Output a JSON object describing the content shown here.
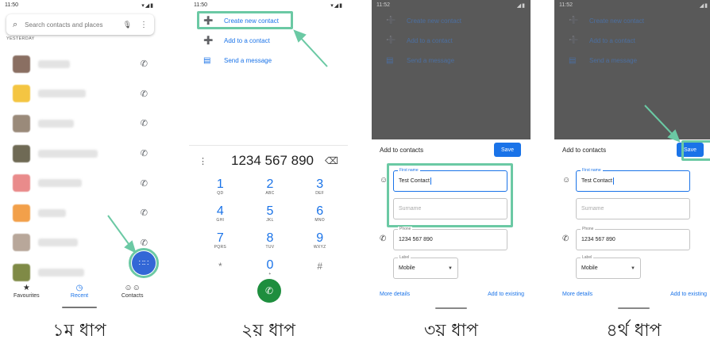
{
  "colors": {
    "accent": "#1a73e8",
    "highlight": "#6bc9a4",
    "call_green": "#1e8e3e",
    "overlay": "#595959"
  },
  "step1": {
    "status_time": "11:50",
    "search_placeholder": "Search contacts and places",
    "section_label": "YESTERDAY",
    "calls": [
      {
        "avatar": "#8a6f62"
      },
      {
        "avatar": "#f4c542"
      },
      {
        "avatar": "#9a8a7a"
      },
      {
        "avatar": "#6f6a55"
      },
      {
        "avatar": "#e98b8b"
      },
      {
        "avatar": "#f2a04a"
      },
      {
        "avatar": "#b8a79a"
      },
      {
        "avatar": "#7f8a46"
      }
    ],
    "nav": [
      {
        "label": "Favourites",
        "icon": "star-icon"
      },
      {
        "label": "Recent",
        "icon": "clock-icon"
      },
      {
        "label": "Contacts",
        "icon": "people-icon"
      }
    ],
    "caption": "১ম ধাপ"
  },
  "step2": {
    "status_time": "11:50",
    "menu": [
      {
        "label": "Create new contact",
        "icon": "person-add-icon"
      },
      {
        "label": "Add to a contact",
        "icon": "person-add-icon"
      },
      {
        "label": "Send a message",
        "icon": "message-icon"
      }
    ],
    "number": "1234 567 890",
    "keys": [
      {
        "digit": "1",
        "letters": "QD"
      },
      {
        "digit": "2",
        "letters": "ABC"
      },
      {
        "digit": "3",
        "letters": "DEF"
      },
      {
        "digit": "4",
        "letters": "GHI"
      },
      {
        "digit": "5",
        "letters": "JKL"
      },
      {
        "digit": "6",
        "letters": "MNO"
      },
      {
        "digit": "7",
        "letters": "PQRS"
      },
      {
        "digit": "8",
        "letters": "TUV"
      },
      {
        "digit": "9",
        "letters": "WXYZ"
      },
      {
        "digit": "*",
        "letters": ""
      },
      {
        "digit": "0",
        "letters": "+"
      },
      {
        "digit": "#",
        "letters": ""
      }
    ],
    "caption": "২য় ধাপ"
  },
  "step3": {
    "status_time": "11:52",
    "title": "Add to contacts",
    "save": "Save",
    "first_name_label": "First name",
    "first_name_value": "Test Contact",
    "surname_placeholder": "Surname",
    "phone_label": "Phone",
    "phone_value": "1234 567 890",
    "type_label": "Label",
    "type_value": "Mobile",
    "more_details": "More details",
    "add_existing": "Add to existing",
    "caption": "৩য় ধাপ"
  },
  "step4": {
    "status_time": "11:52",
    "title": "Add to contacts",
    "save": "Save",
    "first_name_label": "First name",
    "first_name_value": "Test Contact",
    "surname_placeholder": "Surname",
    "phone_label": "Phone",
    "phone_value": "1234 567 890",
    "type_label": "Label",
    "type_value": "Mobile",
    "more_details": "More details",
    "add_existing": "Add to existing",
    "caption": "৪র্থ ধাপ"
  }
}
